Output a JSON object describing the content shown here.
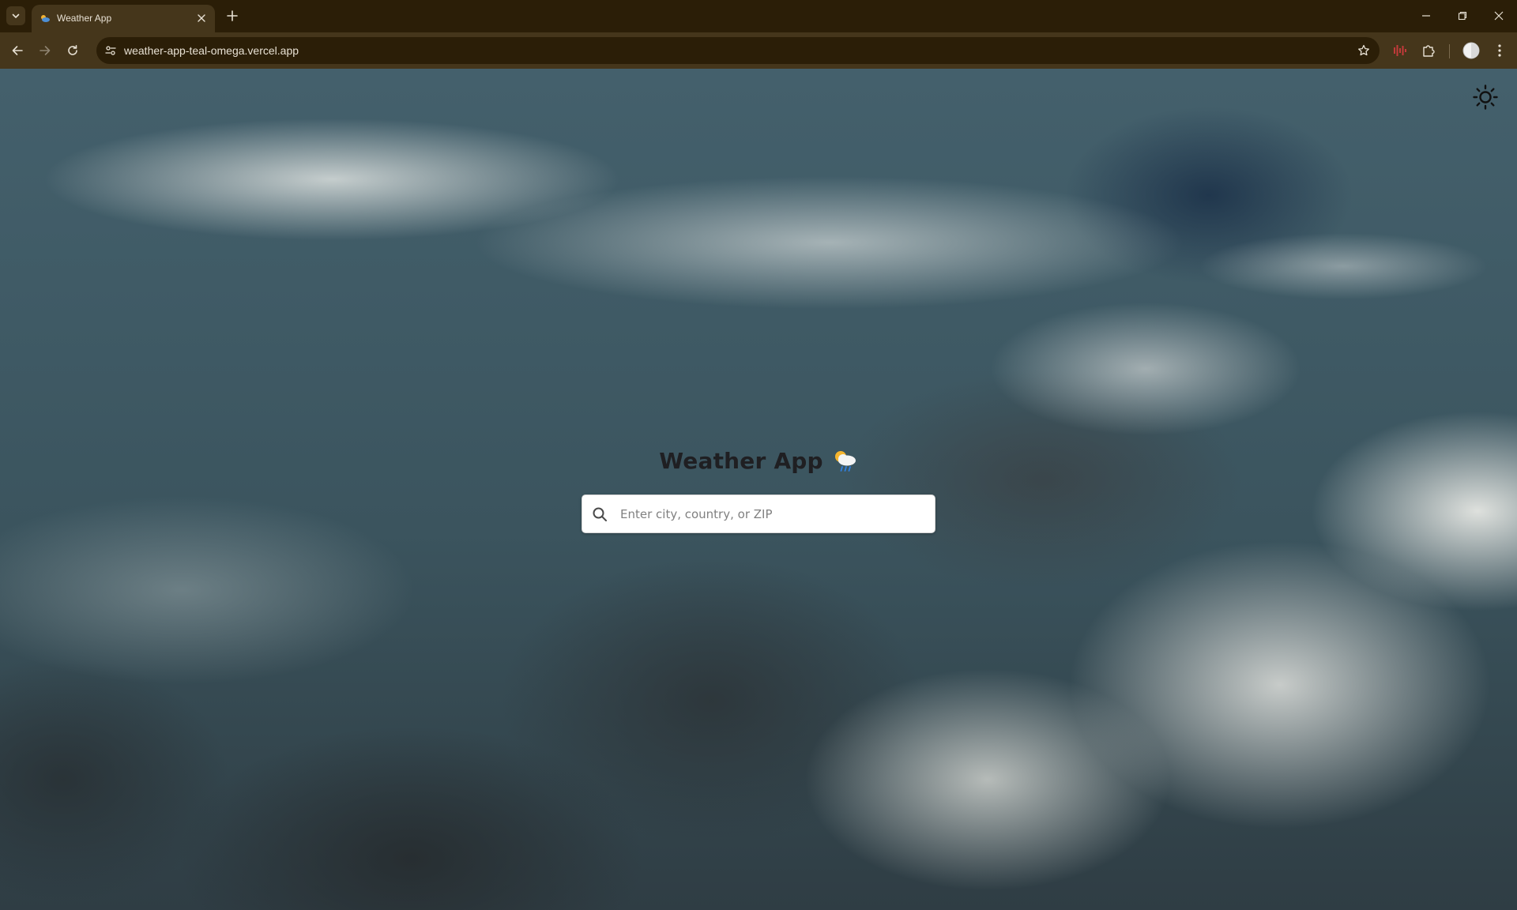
{
  "browser": {
    "tab": {
      "title": "Weather App",
      "favicon": "weather-favicon-icon"
    },
    "url": "weather-app-teal-omega.vercel.app",
    "icons": {
      "tab_search": "chevron-down-icon",
      "new_tab": "plus-icon",
      "back": "arrow-left-icon",
      "forward": "arrow-right-icon",
      "reload": "reload-icon",
      "site_info": "site-settings-icon",
      "bookmark": "star-icon",
      "extension": "audio-bars-icon",
      "extensions": "puzzle-icon",
      "profile": "avatar-icon",
      "menu": "kebab-menu-icon"
    }
  },
  "page": {
    "title": "Weather App",
    "title_emoji": "cloud-rain-emoji",
    "search": {
      "placeholder": "Enter city, country, or ZIP",
      "value": ""
    },
    "theme_toggle_icon": "sun-icon"
  },
  "colors": {
    "chrome_dark": "#2b1e07",
    "chrome_light": "#45361b",
    "title_text": "#1f1f22",
    "sky_base": "#3f5a65"
  }
}
